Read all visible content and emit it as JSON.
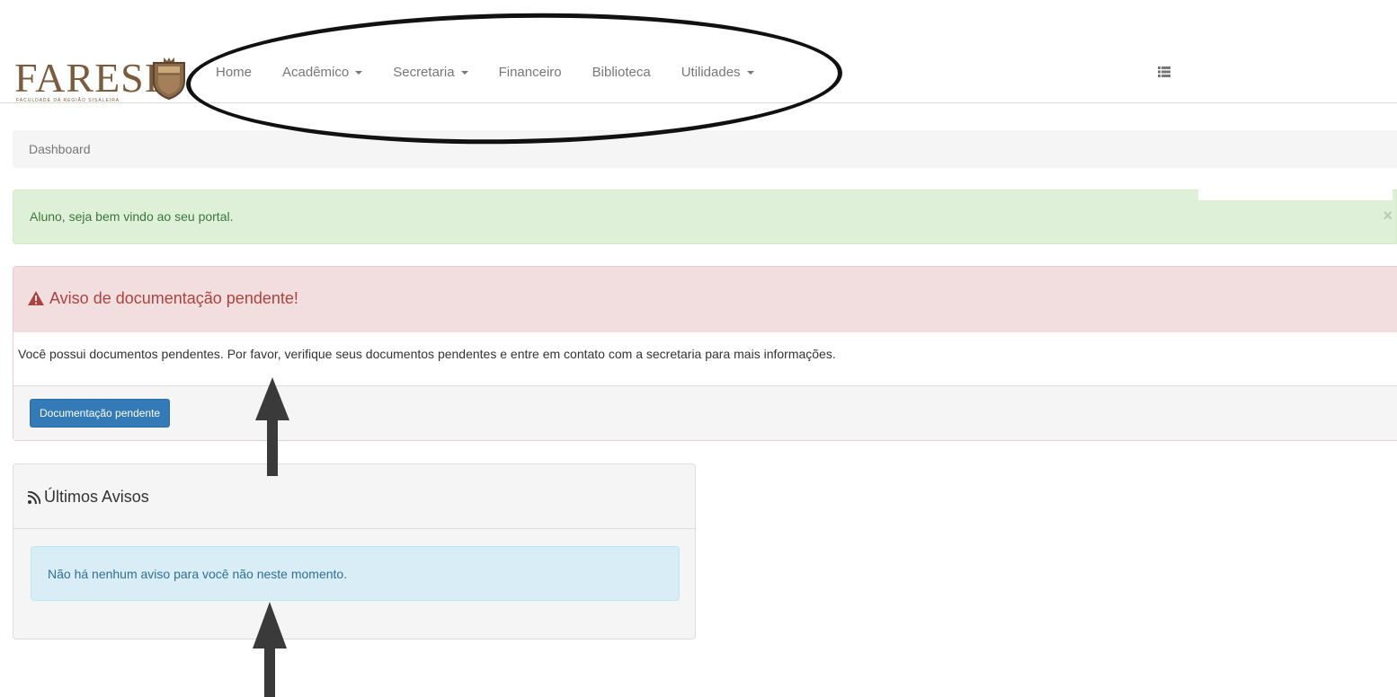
{
  "navbar": {
    "logo_text": "FARESI",
    "logo_subtitle": "FACULDADE DA REGIÃO SISALEIRA",
    "items": [
      {
        "label": "Home",
        "dropdown": false
      },
      {
        "label": "Acadêmico",
        "dropdown": true
      },
      {
        "label": "Secretaria",
        "dropdown": true
      },
      {
        "label": "Financeiro",
        "dropdown": false
      },
      {
        "label": "Biblioteca",
        "dropdown": false
      },
      {
        "label": "Utilidades",
        "dropdown": true
      }
    ],
    "toggle_icon": "list-icon"
  },
  "breadcrumb": {
    "label": "Dashboard"
  },
  "success_alert": {
    "message": "Aluno, seja bem vindo ao seu portal.",
    "close": "×"
  },
  "document_panel": {
    "title": "Aviso de documentação pendente!",
    "icon": "warning-icon",
    "body": "Você possui documentos pendentes. Por favor, verifique seus documentos pendentes e entre em contato com a secretaria para mais informações.",
    "button_label": "Documentação pendente"
  },
  "notices_panel": {
    "title": "Últimos Avisos",
    "icon": "rss-icon",
    "message": "Não há nenhum aviso para você não neste momento."
  },
  "colors": {
    "brand": "#7b5b3e",
    "success_bg": "#dff0d8",
    "danger_bg": "#f2dede",
    "danger_text": "#a94442",
    "primary": "#337ab7",
    "info_bg": "#d9edf7",
    "info_text": "#31708f"
  }
}
